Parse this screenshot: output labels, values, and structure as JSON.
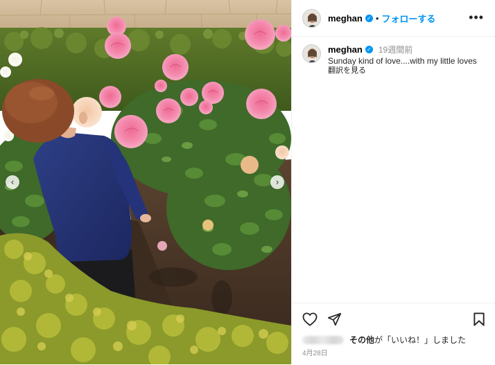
{
  "header": {
    "username": "meghan",
    "separator": "•",
    "follow_label": "フォローする",
    "more_label": "•••",
    "verified_glyph": "✓"
  },
  "caption": {
    "username": "meghan",
    "time_ago": "19週間前",
    "text": "Sunday kind of love....with my little loves",
    "translate_label": "翻訳を見る"
  },
  "carousel": {
    "prev_glyph": "‹",
    "next_glyph": "›"
  },
  "actions": {
    "icons": [
      "heart-icon",
      "share-icon",
      "bookmark-icon"
    ],
    "likes_prefix": "その他",
    "likes_suffix": "が「いいね！」しました",
    "date": "4月28日"
  },
  "colors": {
    "accent": "#0095f6",
    "muted": "#8e8e8e",
    "text": "#262626"
  }
}
